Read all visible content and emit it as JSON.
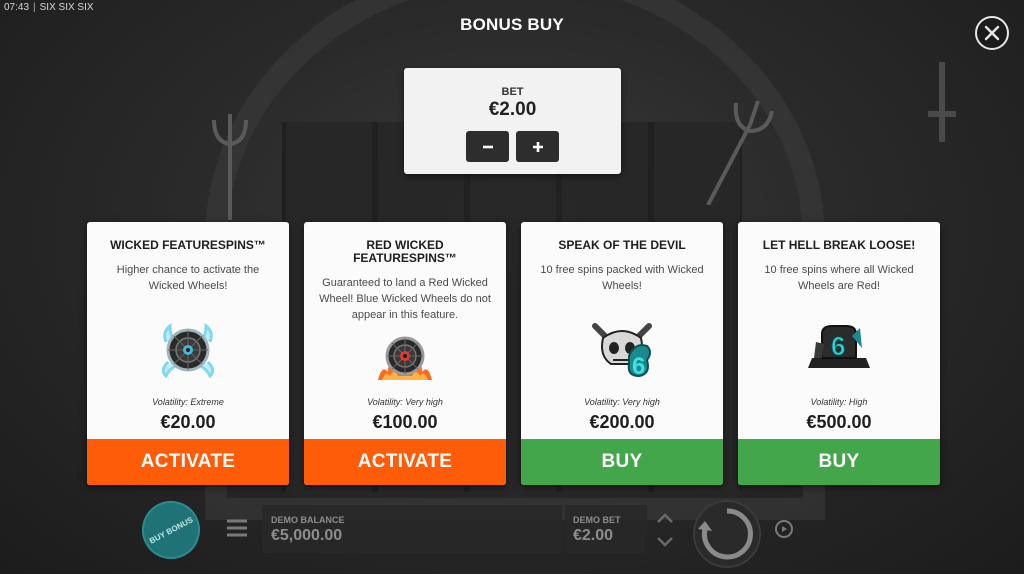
{
  "topbar": {
    "time": "07:43",
    "game_name": "SIX SIX SIX"
  },
  "header": {
    "title": "BONUS BUY"
  },
  "bet": {
    "label": "BET",
    "value": "€2.00"
  },
  "cards": [
    {
      "title": "WICKED FEATURESPINS™",
      "description": "Higher chance to activate the Wicked Wheels!",
      "icon": "blue-wicked-wheel-icon",
      "volatility": "Volatility: Extreme",
      "price": "€20.00",
      "button": "ACTIVATE",
      "button_color": "#ff5c0a"
    },
    {
      "title": "RED WICKED FEATURESPINS™",
      "description": "Guaranteed to land a Red Wicked Wheel! Blue Wicked Wheels do not appear in this feature.",
      "icon": "red-wicked-wheel-icon",
      "volatility": "Volatility: Very high",
      "price": "€100.00",
      "button": "ACTIVATE",
      "button_color": "#ff5c0a"
    },
    {
      "title": "SPEAK OF THE DEVIL",
      "description": "10 free spins packed with Wicked Wheels!",
      "icon": "devil-skull-six-icon",
      "volatility": "Volatility: Very high",
      "price": "€200.00",
      "button": "BUY",
      "button_color": "#43a64a"
    },
    {
      "title": "LET HELL BREAK LOOSE!",
      "description": "10 free spins where all Wicked Wheels are Red!",
      "icon": "tombstone-six-icon",
      "volatility": "Volatility: High",
      "price": "€500.00",
      "button": "BUY",
      "button_color": "#43a64a"
    }
  ],
  "bottom": {
    "buy_bonus": "BUY BONUS",
    "balance_label": "DEMO BALANCE",
    "balance_value": "€5,000.00",
    "bet_label": "DEMO BET",
    "bet_value": "€2.00"
  },
  "colors": {
    "activate": "#ff5c0a",
    "buy": "#43a64a",
    "buy_bonus": "#1f7275"
  }
}
